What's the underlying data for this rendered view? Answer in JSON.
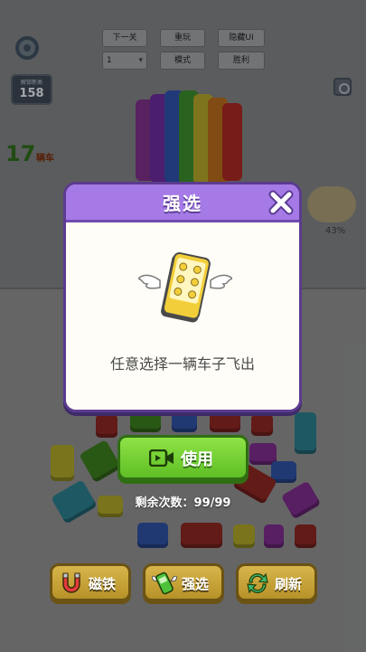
{
  "debug_bar": {
    "next_level": "下一关",
    "replay": "重玩",
    "hide_ui": "隐藏UI",
    "level_select_value": "1",
    "mode": "模式",
    "win": "胜利"
  },
  "hud": {
    "level_label": "解锁新类",
    "level_value": "158",
    "car_count": "17",
    "car_count_label": "辆车",
    "progress_percent": "43%"
  },
  "modal": {
    "title": "强选",
    "description": "任意选择一辆车子飞出"
  },
  "use_button": {
    "label": "使用"
  },
  "remaining": {
    "text": "剩余次数：99/99"
  },
  "tools": [
    {
      "label": "磁铁",
      "icon": "magnet-icon"
    },
    {
      "label": "强选",
      "icon": "pick-car-icon"
    },
    {
      "label": "刷新",
      "icon": "refresh-icon"
    }
  ],
  "colors": {
    "modal_header": "#a57ae6",
    "use_button": "#6ccd2f",
    "tool_button": "#c9a53a"
  }
}
